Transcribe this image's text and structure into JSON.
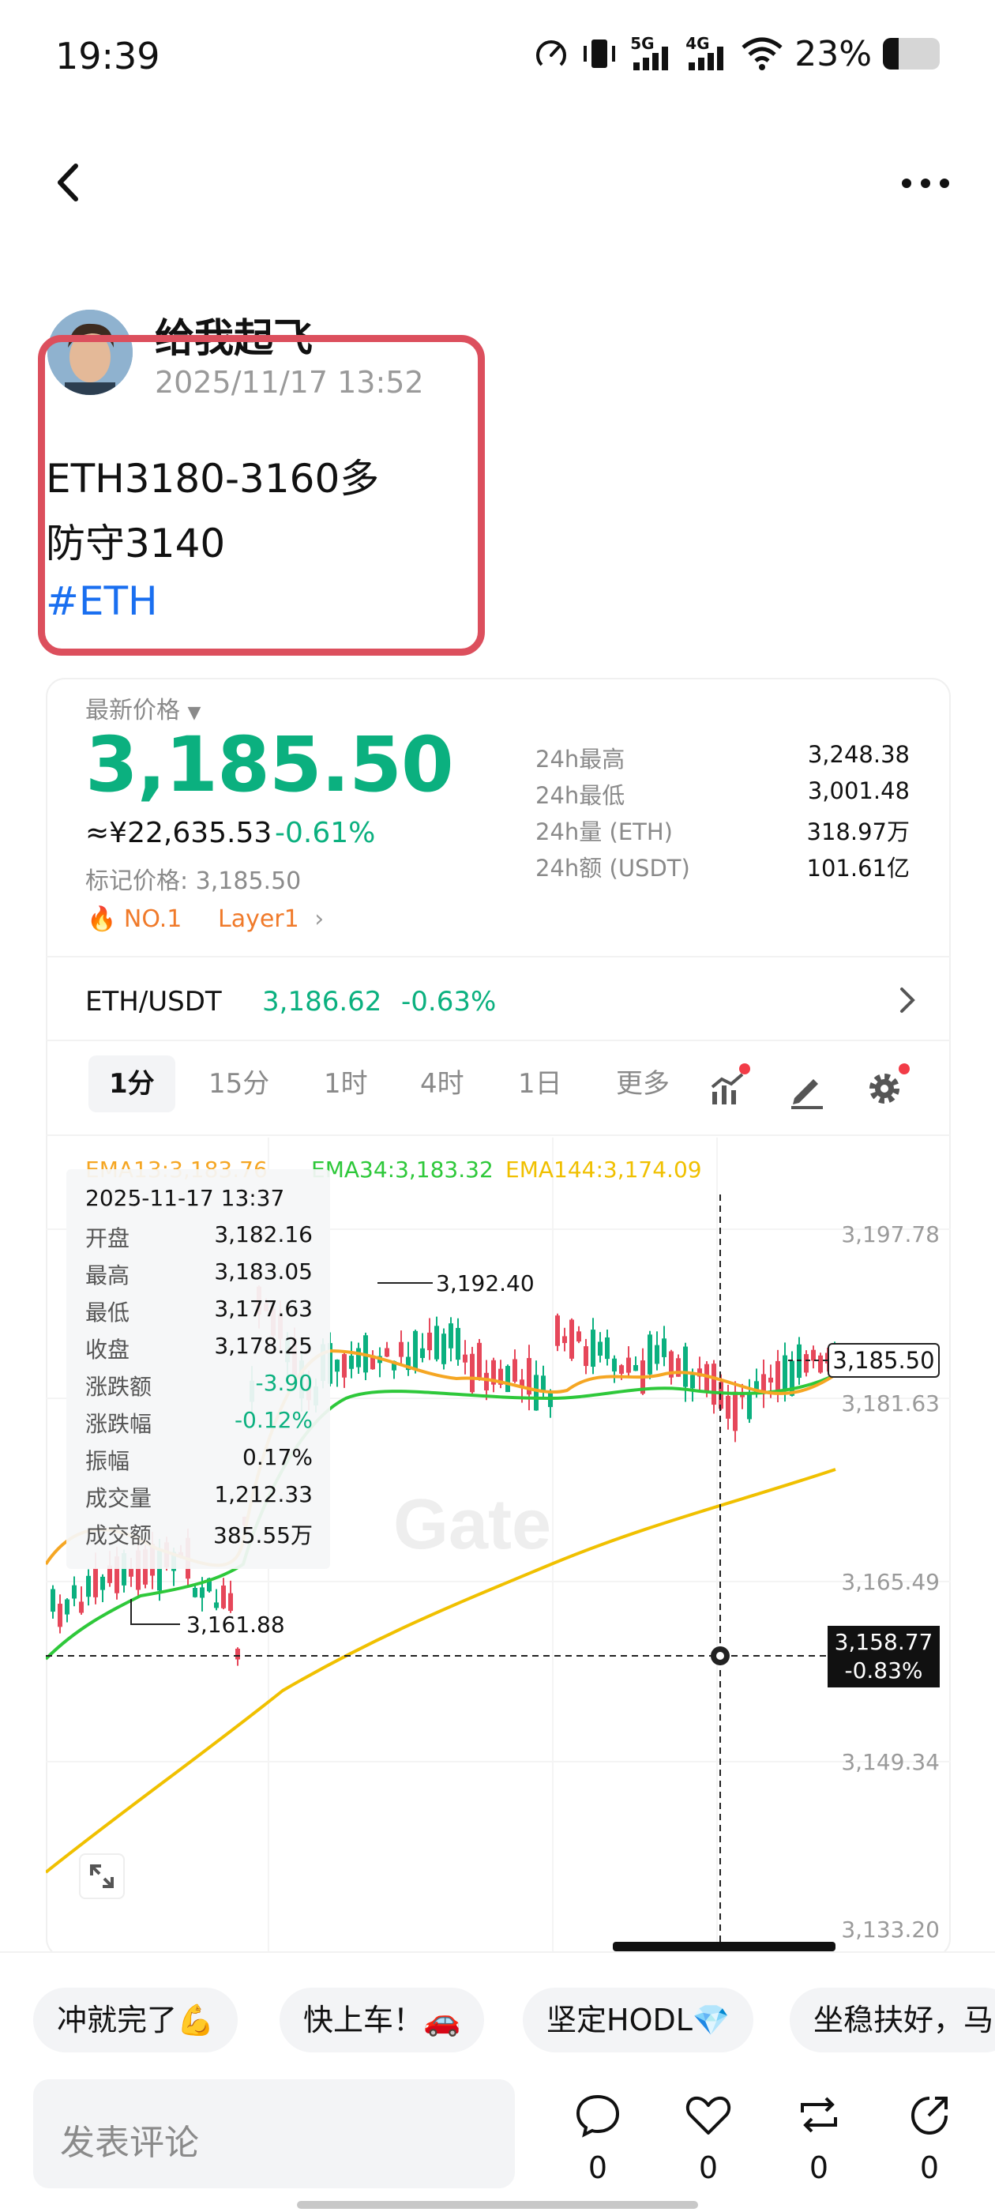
{
  "status_bar": {
    "time": "19:39",
    "signal_5g": "5G",
    "signal_4g": "4G",
    "battery": "23%"
  },
  "post": {
    "author": "给我起飞",
    "timestamp": "2025/11/17 13:52",
    "line1": "ETH3180-3160多",
    "line2": "防守3140",
    "hashtag": "#ETH"
  },
  "market": {
    "latest_label": "最新价格",
    "price": "3,185.50",
    "cny_value": "≈¥22,635.53",
    "change": "-0.61%",
    "mark_price": "标记价格: 3,185.50",
    "rank_tag": "NO.1",
    "category_tag": "Layer1",
    "stats": [
      {
        "label": "24h最高",
        "value": "3,248.38"
      },
      {
        "label": "24h最低",
        "value": "3,001.48"
      },
      {
        "label": "24h量 (ETH)",
        "value": "318.97万"
      },
      {
        "label": "24h额 (USDT)",
        "value": "101.61亿"
      }
    ],
    "pair": {
      "name": "ETH/USDT",
      "price": "3,186.62",
      "change": "-0.63%"
    },
    "accent_color": "#0bb07f",
    "highlight_color": "#dc4f5d"
  },
  "tabs": [
    "1分",
    "15分",
    "1时",
    "4时",
    "1日",
    "更多"
  ],
  "active_tab": "1分",
  "chart": {
    "ema13": "EMA13:3,183.76",
    "ema34": "EMA34:3,183.32",
    "ema144": "EMA144:3,174.09",
    "axis": [
      "3,197.78",
      "3,181.63",
      "3,165.49",
      "3,149.34",
      "3,133.20"
    ],
    "current_price_tag": "3,185.50",
    "cross_price": "3,158.77",
    "cross_change": "-0.83%",
    "high_annotation": "3,192.40",
    "low_annotation": "3,161.88",
    "watermark": "Gate",
    "info": {
      "date": "2025-11-17 13:37",
      "rows": [
        {
          "label": "开盘",
          "value": "3,182.16"
        },
        {
          "label": "最高",
          "value": "3,183.05"
        },
        {
          "label": "最低",
          "value": "3,177.63"
        },
        {
          "label": "收盘",
          "value": "3,178.25"
        },
        {
          "label": "涨跌额",
          "value": "-3.90"
        },
        {
          "label": "涨跌幅",
          "value": "-0.12%"
        },
        {
          "label": "振幅",
          "value": "0.17%"
        },
        {
          "label": "成交量",
          "value": "1,212.33"
        },
        {
          "label": "成交额",
          "value": "385.55万"
        }
      ]
    }
  },
  "quick_replies": [
    "冲就完了💪",
    "快上车！🚗",
    "坚定HODL💎",
    "坐稳扶好，马"
  ],
  "comment_placeholder": "发表评论",
  "actions": {
    "comments": "0",
    "likes": "0",
    "reposts": "0",
    "shares": "0"
  }
}
